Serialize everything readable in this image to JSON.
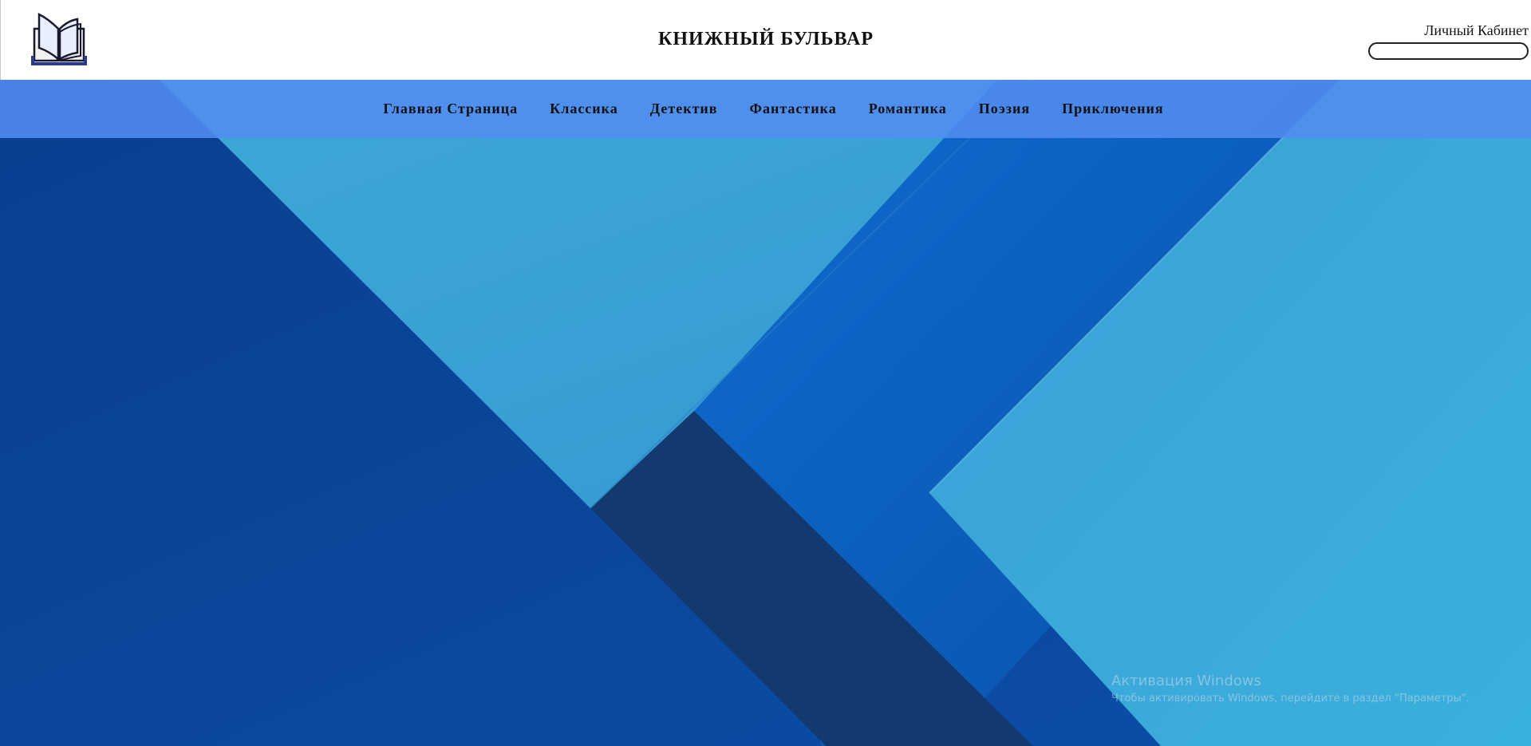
{
  "header": {
    "logo_icon": "open-book-icon",
    "title": "КНИЖНЫЙ БУЛЬВАР",
    "account_label": "Личный Кабинет",
    "account_input_value": ""
  },
  "nav": {
    "items": [
      {
        "label": "Главная Страница"
      },
      {
        "label": "Классика"
      },
      {
        "label": "Детектив"
      },
      {
        "label": "Фантастика"
      },
      {
        "label": "Романтика"
      },
      {
        "label": "Поэзия"
      },
      {
        "label": "Приключения"
      }
    ]
  },
  "colors": {
    "nav_background": "#528cf0",
    "hero_dark_blue": "#0a4aa0",
    "hero_light_blue": "#3aa2d6",
    "hero_navy": "#123a70"
  },
  "watermark": {
    "title": "Активация Windows",
    "subtitle": "Чтобы активировать Windows, перейдите в раздел \"Параметры\"."
  }
}
